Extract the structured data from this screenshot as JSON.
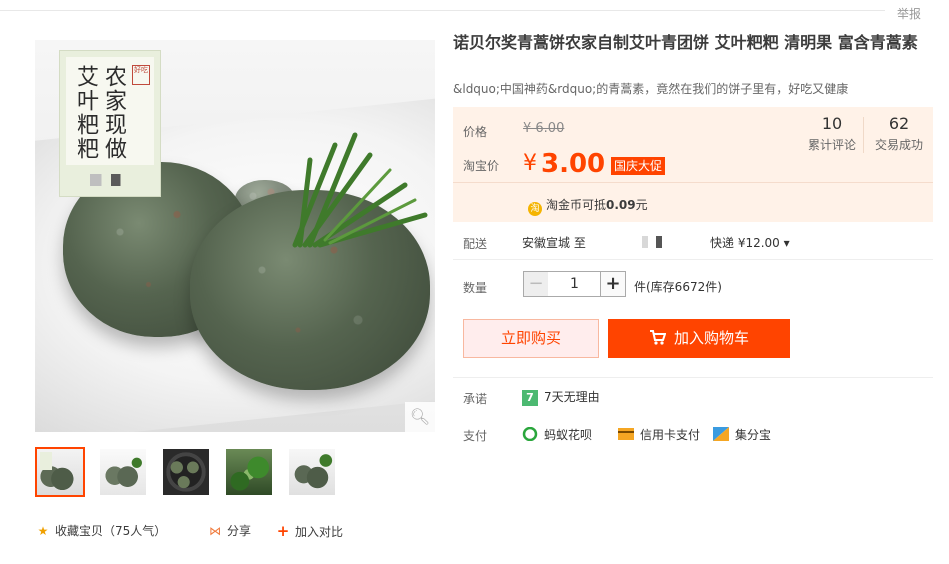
{
  "header": {
    "report_label": "举报"
  },
  "gallery": {
    "label_card": {
      "line1": "艾叶粑粑",
      "line2": "农家现做",
      "seal": "好吃"
    },
    "zoom_icon": "magnifier-icon",
    "thumbnails": [
      {
        "name": "thumb-1",
        "active": true
      },
      {
        "name": "thumb-2",
        "active": false
      },
      {
        "name": "thumb-3",
        "active": false
      },
      {
        "name": "thumb-4",
        "active": false
      },
      {
        "name": "thumb-5",
        "active": false
      }
    ]
  },
  "actions": {
    "favorite": "收藏宝贝（75人气）",
    "share": "分享",
    "compare": "加入对比"
  },
  "product": {
    "title": "诺贝尔奖青蒿饼农家自制艾叶青团饼 艾叶粑粑 清明果 富含青蒿素",
    "subtitle": "&ldquo;中国神药&rdquo;的青蒿素，竟然在我们的饼子里有，好吃又健康"
  },
  "price": {
    "original_label": "价格",
    "original_value": "¥ 6.00",
    "taobao_label": "淘宝价",
    "currency": "¥",
    "current_value": "3.00",
    "promo_badge": "国庆大促",
    "coin_text": "淘金币可抵",
    "coin_amount": "0.09",
    "coin_unit": "元",
    "coin_icon_char": "淘"
  },
  "stats": {
    "reviews_count": "10",
    "reviews_label": "累计评论",
    "sales_count": "62",
    "sales_label": "交易成功"
  },
  "shipping": {
    "label": "配送",
    "origin": "安徽宣城 至",
    "fee": "快递 ¥12.00 ▾"
  },
  "quantity": {
    "label": "数量",
    "minus": "−",
    "value": "1",
    "plus": "+",
    "stock": "件(库存6672件)"
  },
  "buttons": {
    "buy_now": "立即购买",
    "add_to_cart": "加入购物车"
  },
  "promise": {
    "label": "承诺",
    "badge": "7",
    "text": "7天无理由"
  },
  "payment": {
    "label": "支付",
    "methods": [
      "蚂蚁花呗",
      "信用卡支付",
      "集分宝"
    ]
  },
  "colors": {
    "accent": "#ff4400",
    "price_bg": "#fff2e8",
    "promise_green": "#4cb971"
  }
}
